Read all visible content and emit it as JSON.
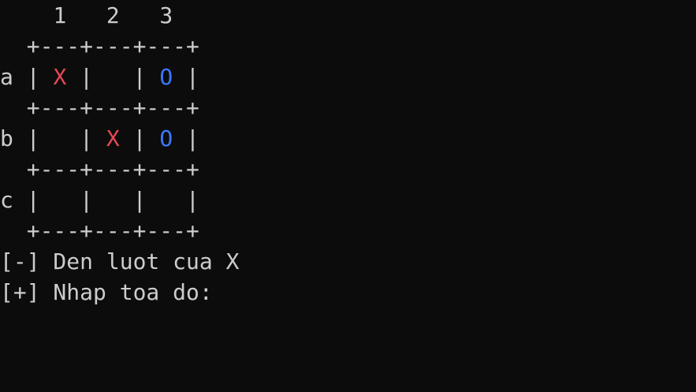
{
  "board": {
    "column_headers": [
      "1",
      "2",
      "3"
    ],
    "separator": "+---+---+---+",
    "rows": [
      {
        "label": "a",
        "cells": [
          "X",
          "",
          "O"
        ]
      },
      {
        "label": "b",
        "cells": [
          "",
          "X",
          "O"
        ]
      },
      {
        "label": "c",
        "cells": [
          "",
          "",
          ""
        ]
      }
    ]
  },
  "status": {
    "turn_prompt": "[-] Den luot cua X",
    "input_prompt": "[+] Nhap toa do:"
  },
  "colors": {
    "background": "#0c0c0c",
    "text": "#cccccc",
    "player_x": "#e74856",
    "player_o": "#3b78ff"
  }
}
